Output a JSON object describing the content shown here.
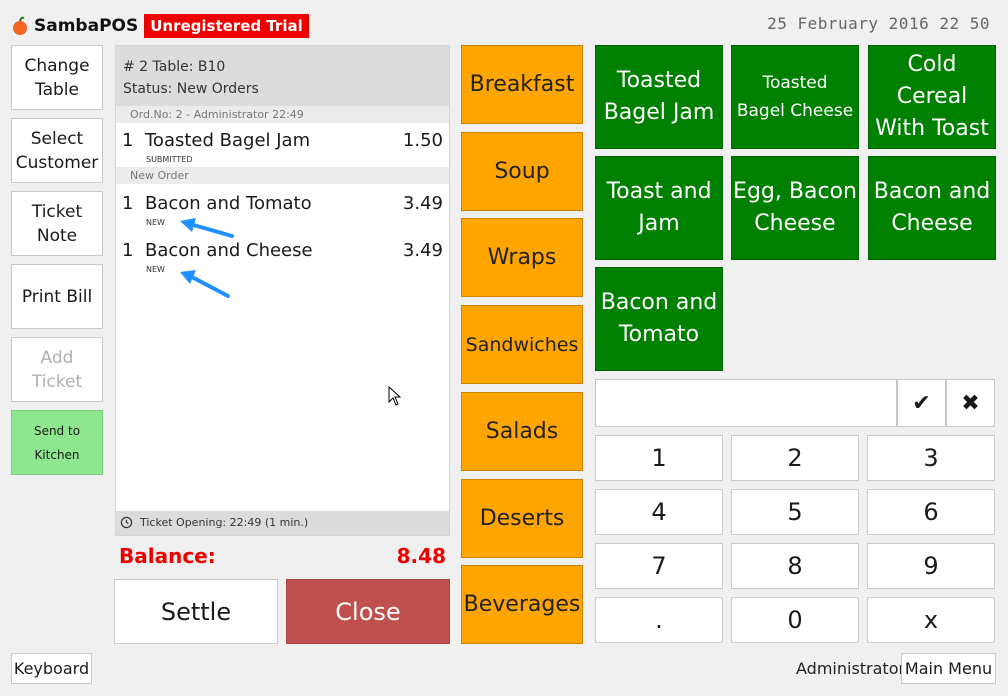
{
  "header": {
    "logo_text": "SambaPOS",
    "trial_badge": "Unregistered Trial",
    "datetime": "25 February 2016 22 50"
  },
  "left_buttons": {
    "change_table": "Change\nTable",
    "select_customer": "Select\nCustomer",
    "ticket_note": "Ticket\nNote",
    "print_bill": "Print Bill",
    "add_ticket": "Add\nTicket",
    "send_to_kitchen": "Send to Kitchen"
  },
  "ticket": {
    "title": "# 2 Table: B10",
    "status": "Status: New Orders",
    "order_group_1": "Ord.No: 2 - Administrator 22:49",
    "order_group_2": "New Order",
    "items": [
      {
        "qty": "1",
        "name": "Toasted Bagel Jam",
        "price": "1.50",
        "state": "SUBMITTED"
      },
      {
        "qty": "1",
        "name": "Bacon and Tomato",
        "price": "3.49",
        "state": "NEW"
      },
      {
        "qty": "1",
        "name": "Bacon and Cheese",
        "price": "3.49",
        "state": "NEW"
      }
    ],
    "footer": "Ticket Opening:    22:49 (1 min.)"
  },
  "balance": {
    "label": "Balance:",
    "value": "8.48"
  },
  "actions": {
    "settle": "Settle",
    "close": "Close"
  },
  "categories": [
    "Breakfast",
    "Soup",
    "Wraps",
    "Sandwiches",
    "Salads",
    "Deserts",
    "Beverages"
  ],
  "products": [
    "Toasted\nBagel Jam",
    "Toasted\nBagel Cheese",
    "Cold Cereal\nWith Toast",
    "Toast and\nJam",
    "Egg, Bacon\nCheese",
    "Bacon and\nCheese",
    "Bacon and\nTomato"
  ],
  "numpad": {
    "ok": "✔",
    "clear": "✖",
    "keys": [
      "1",
      "2",
      "3",
      "4",
      "5",
      "6",
      "7",
      "8",
      "9",
      ".",
      "0",
      "x"
    ]
  },
  "footer": {
    "keyboard": "Keyboard",
    "user": "Administrator",
    "main_menu": "Main Menu"
  },
  "colors": {
    "category": "#ffa500",
    "product": "#008000",
    "close": "#c0504d",
    "kitchen": "#8ee68e",
    "alert": "#ee0000"
  }
}
